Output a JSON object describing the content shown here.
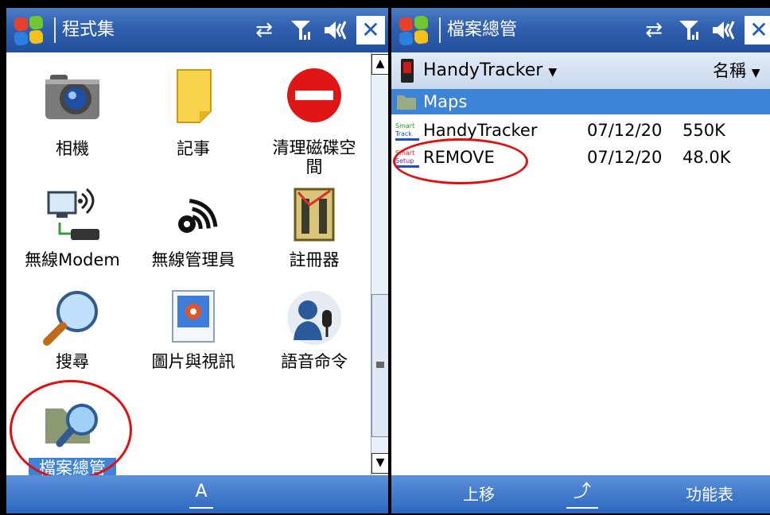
{
  "left": {
    "title": "程式集",
    "apps": [
      {
        "label": "相機",
        "icon": "camera-icon"
      },
      {
        "label": "記事",
        "icon": "notes-icon"
      },
      {
        "label": "清理磁碟空\n間",
        "icon": "no-entry-icon"
      },
      {
        "label": "無線Modem",
        "icon": "wireless-modem-icon"
      },
      {
        "label": "無線管理員",
        "icon": "wireless-signal-icon"
      },
      {
        "label": "註冊器",
        "icon": "registry-icon"
      },
      {
        "label": "搜尋",
        "icon": "magnifier-icon"
      },
      {
        "label": "圖片與視訊",
        "icon": "picture-icon"
      },
      {
        "label": "語音命令",
        "icon": "voice-command-icon"
      },
      {
        "label": "檔案總管",
        "icon": "file-explorer-icon"
      }
    ],
    "softkey_center": "A"
  },
  "right": {
    "title": "檔案總管",
    "location": "HandyTracker",
    "sort_label": "名稱",
    "folder": "Maps",
    "files": [
      {
        "name": "HandyTracker",
        "date": "07/12/20",
        "size": "550K",
        "icon": "smart-track-icon"
      },
      {
        "name": "REMOVE",
        "date": "07/12/20",
        "size": "48.0K",
        "icon": "smart-setup-icon"
      }
    ],
    "softkeys": {
      "left": "上移",
      "center": "⤴",
      "right": "功能表"
    }
  },
  "colors": {
    "titlebar": "#2f5fae",
    "selection": "#3d84d6",
    "annotation": "#e01010"
  }
}
